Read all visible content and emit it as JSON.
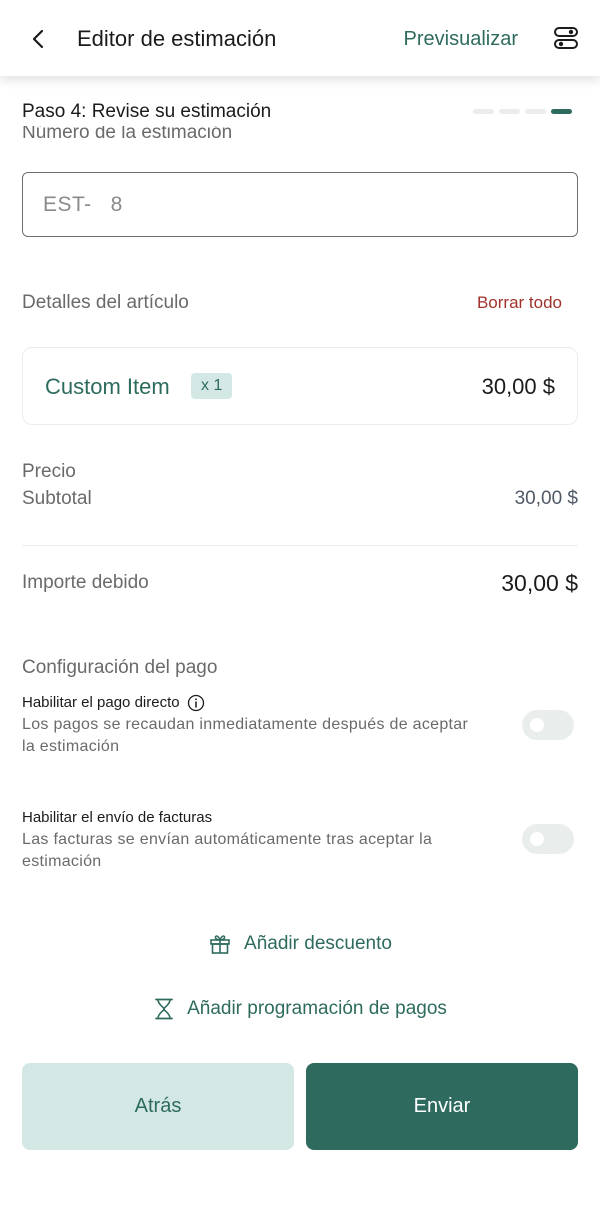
{
  "header": {
    "title": "Editor de estimación",
    "preview_label": "Previsualizar"
  },
  "step": {
    "label": "Paso 4: Revise su estimación",
    "total_steps": 4,
    "current_step": 4
  },
  "estimate_number": {
    "label": "Número de la estimación",
    "value": "EST-   8"
  },
  "items": {
    "section_title": "Detalles del artículo",
    "clear_label": "Borrar todo",
    "list": [
      {
        "name": "Custom Item",
        "quantity": "x 1",
        "amount": "30,00 $"
      }
    ]
  },
  "price": {
    "label": "Precio",
    "subtotal_label": "Subtotal",
    "subtotal_value": "30,00 $",
    "due_label": "Importe debido",
    "due_value": "30,00 $"
  },
  "payment_config": {
    "title": "Configuración del pago",
    "direct_payment": {
      "title": "Habilitar el pago directo",
      "description": "Los pagos se recaudan inmediatamente después de aceptar la estimación",
      "enabled": false
    },
    "invoice_sending": {
      "title": "Habilitar el envío de facturas",
      "description": "Las facturas se envían automáticamente tras aceptar la estimación",
      "enabled": false
    }
  },
  "actions": {
    "add_discount": "Añadir descuento",
    "add_payment_schedule": "Añadir programación de pagos"
  },
  "buttons": {
    "back": "Atrás",
    "send": "Enviar"
  },
  "colors": {
    "brand": "#2e6b5e",
    "brand_light": "#d3e8e5",
    "danger": "#a0332b"
  }
}
